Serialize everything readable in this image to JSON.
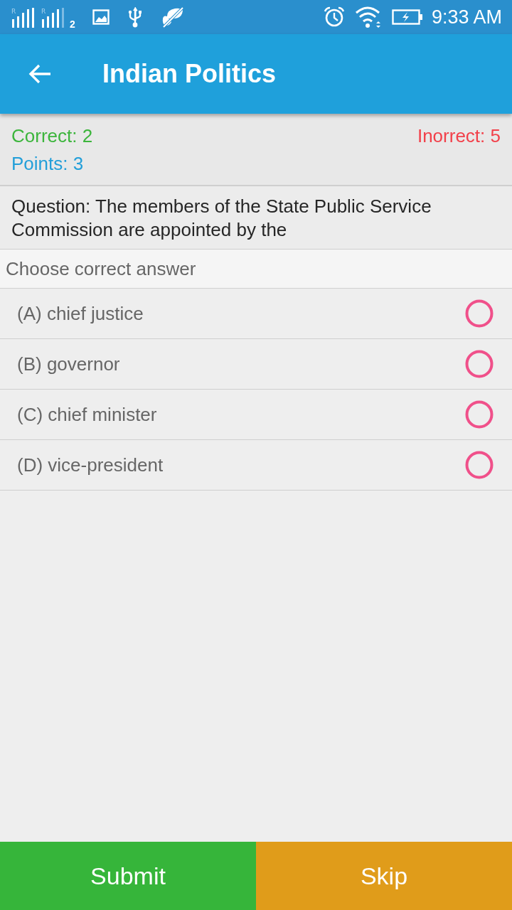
{
  "status_bar": {
    "signals": [
      {
        "roaming_label": "R"
      },
      {
        "roaming_label": "R"
      }
    ],
    "sim_label": "2",
    "time": "9:33 AM"
  },
  "toolbar": {
    "title": "Indian Politics"
  },
  "score": {
    "correct": "Correct: 2",
    "incorrect": "Inorrect: 5",
    "points": "Points: 3"
  },
  "question": "Question: The members of the State Public Service Commission are appointed by the",
  "prompt": "Choose correct answer",
  "options": [
    {
      "label": "(A) chief justice",
      "selected": false
    },
    {
      "label": "(B) governor",
      "selected": false
    },
    {
      "label": "(C) chief minister",
      "selected": false
    },
    {
      "label": "(D) vice-president",
      "selected": false
    }
  ],
  "buttons": [
    {
      "label": "Submit",
      "kind": "submit"
    },
    {
      "label": "Skip",
      "kind": "skip"
    }
  ]
}
